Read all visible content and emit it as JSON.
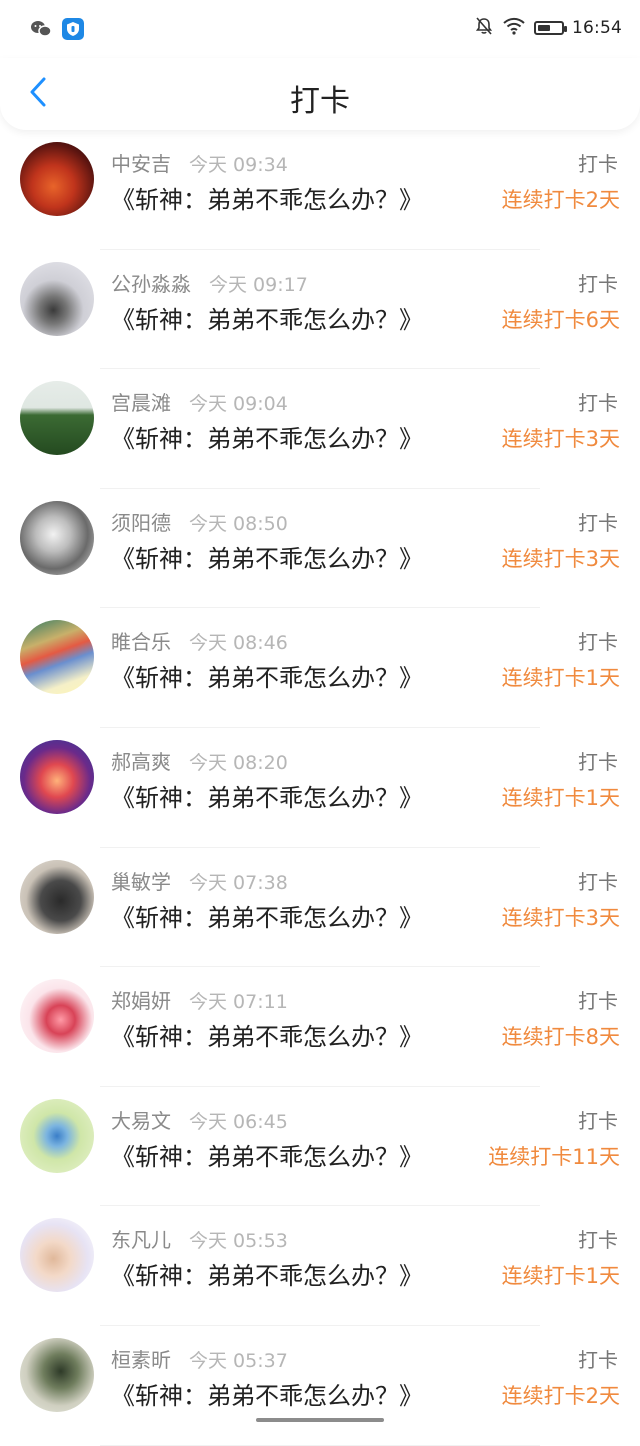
{
  "status": {
    "time": "16:54",
    "battery_level": 0.55,
    "icons": [
      "wechat-icon",
      "shield-app-icon",
      "bell-off-icon",
      "wifi-icon",
      "battery-icon"
    ]
  },
  "nav": {
    "title": "打卡",
    "back_icon": "chevron-left-icon",
    "accent": "#1e90ff"
  },
  "colors": {
    "streak": "#f08a3e",
    "name": "#8a8a8a",
    "time": "#b6b6b6"
  },
  "items": [
    {
      "name": "中安吉",
      "time": "今天 09:34",
      "title": "《斩神：弟弟不乖怎么办？》",
      "type": "打卡",
      "streak": "连续打卡2天"
    },
    {
      "name": "公孙淼淼",
      "time": "今天 09:17",
      "title": "《斩神：弟弟不乖怎么办？》",
      "type": "打卡",
      "streak": "连续打卡6天"
    },
    {
      "name": "宫晨滩",
      "time": "今天 09:04",
      "title": "《斩神：弟弟不乖怎么办？》",
      "type": "打卡",
      "streak": "连续打卡3天"
    },
    {
      "name": "须阳德",
      "time": "今天 08:50",
      "title": "《斩神：弟弟不乖怎么办？》",
      "type": "打卡",
      "streak": "连续打卡3天"
    },
    {
      "name": "睢合乐",
      "time": "今天 08:46",
      "title": "《斩神：弟弟不乖怎么办？》",
      "type": "打卡",
      "streak": "连续打卡1天"
    },
    {
      "name": "郝高爽",
      "time": "今天 08:20",
      "title": "《斩神：弟弟不乖怎么办？》",
      "type": "打卡",
      "streak": "连续打卡1天"
    },
    {
      "name": "巢敏学",
      "time": "今天 07:38",
      "title": "《斩神：弟弟不乖怎么办？》",
      "type": "打卡",
      "streak": "连续打卡3天"
    },
    {
      "name": "郑娟妍",
      "time": "今天 07:11",
      "title": "《斩神：弟弟不乖怎么办？》",
      "type": "打卡",
      "streak": "连续打卡8天"
    },
    {
      "name": "大易文",
      "time": "今天 06:45",
      "title": "《斩神：弟弟不乖怎么办？》",
      "type": "打卡",
      "streak": "连续打卡11天"
    },
    {
      "name": "东凡儿",
      "time": "今天 05:53",
      "title": "《斩神：弟弟不乖怎么办？》",
      "type": "打卡",
      "streak": "连续打卡1天"
    },
    {
      "name": "桓素昕",
      "time": "今天 05:37",
      "title": "《斩神：弟弟不乖怎么办？》",
      "type": "打卡",
      "streak": "连续打卡2天"
    }
  ]
}
